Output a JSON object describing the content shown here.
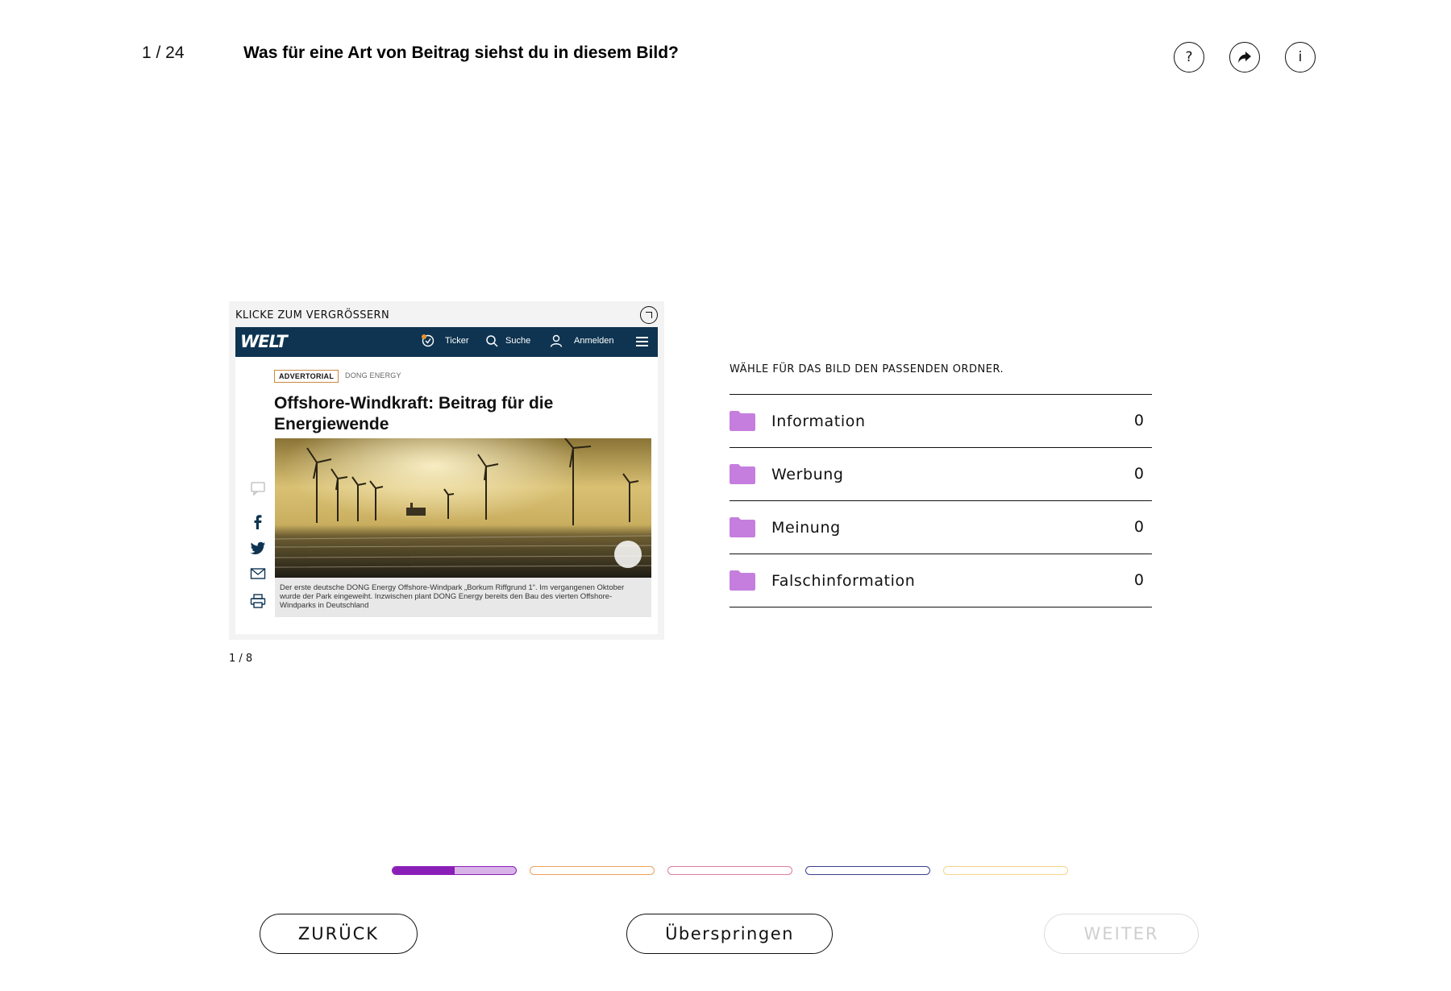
{
  "header": {
    "counter": "1 / 24",
    "question": "Was für eine Art von Beitrag siehst du in diesem Bild?",
    "help_label": "?",
    "info_label": "i"
  },
  "card": {
    "label": "KLICKE ZUM VERGRÖSSERN",
    "image_counter": "1 / 8",
    "screenshot": {
      "logo": "WELT",
      "nav_ticker": "Ticker",
      "nav_search": "Suche",
      "nav_login": "Anmelden",
      "badge": "ADVERTORIAL",
      "sponsor": "DONG ENERGY",
      "title": "Offshore-Windkraft: Beitrag für die Energiewende",
      "caption": "Der erste deutsche DONG Energy Offshore-Windpark „Borkum Riffgrund 1“. Im vergangenen Oktober wurde der Park eingeweiht. Inzwischen plant DONG Energy bereits den Bau des vierten Offshore-Windparks in Deutschland"
    }
  },
  "folders": {
    "label": "WÄHLE FÜR DAS BILD DEN PASSENDEN ORDNER.",
    "color": "#c57ede",
    "items": [
      {
        "name": "Information",
        "count": "0"
      },
      {
        "name": "Werbung",
        "count": "0"
      },
      {
        "name": "Meinung",
        "count": "0"
      },
      {
        "name": "Falschinformation",
        "count": "0"
      }
    ]
  },
  "progress": [
    {
      "color": "#8a1fb8",
      "light": "#d7b3e8",
      "fraction": 0.5
    },
    {
      "color": "#f0a15a",
      "light": "#f0a15a",
      "fraction": 0
    },
    {
      "color": "#e27aa3",
      "light": "#e27aa3",
      "fraction": 0
    },
    {
      "color": "#3c3f8f",
      "light": "#3c3f8f",
      "fraction": 0
    },
    {
      "color": "#f5d58a",
      "light": "#f5d58a",
      "fraction": 0
    }
  ],
  "buttons": {
    "back": "ZURÜCK",
    "skip": "Überspringen",
    "next": "WEITER"
  }
}
